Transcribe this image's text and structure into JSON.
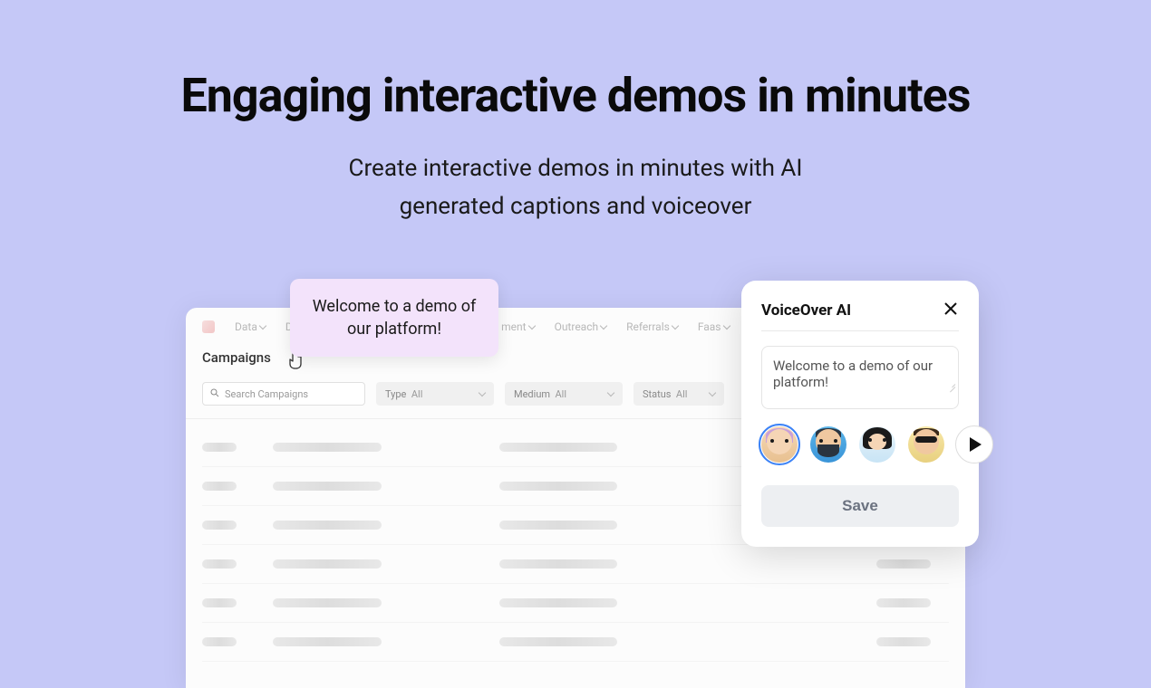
{
  "hero": {
    "title": "Engaging interactive demos in minutes",
    "subtitle_line1": "Create interactive demos in minutes with AI",
    "subtitle_line2": "generated captions and voiceover"
  },
  "demo": {
    "nav": {
      "items": [
        "Data",
        "De",
        "ment",
        "Outreach",
        "Referrals",
        "Faas"
      ]
    },
    "page_title": "Campaigns",
    "search_placeholder": "Search Campaigns",
    "filters": [
      {
        "label": "Type",
        "value": "All"
      },
      {
        "label": "Medium",
        "value": "All"
      },
      {
        "label": "Status",
        "value": "All"
      }
    ]
  },
  "tooltip": {
    "text": "Welcome to a demo of our platform!"
  },
  "voiceover": {
    "title": "VoiceOver AI",
    "textarea_value": "Welcome to a demo of our platform!",
    "save_label": "Save",
    "avatars": [
      "avatar-1",
      "avatar-2",
      "avatar-3",
      "avatar-4"
    ],
    "selected_avatar_index": 0
  }
}
